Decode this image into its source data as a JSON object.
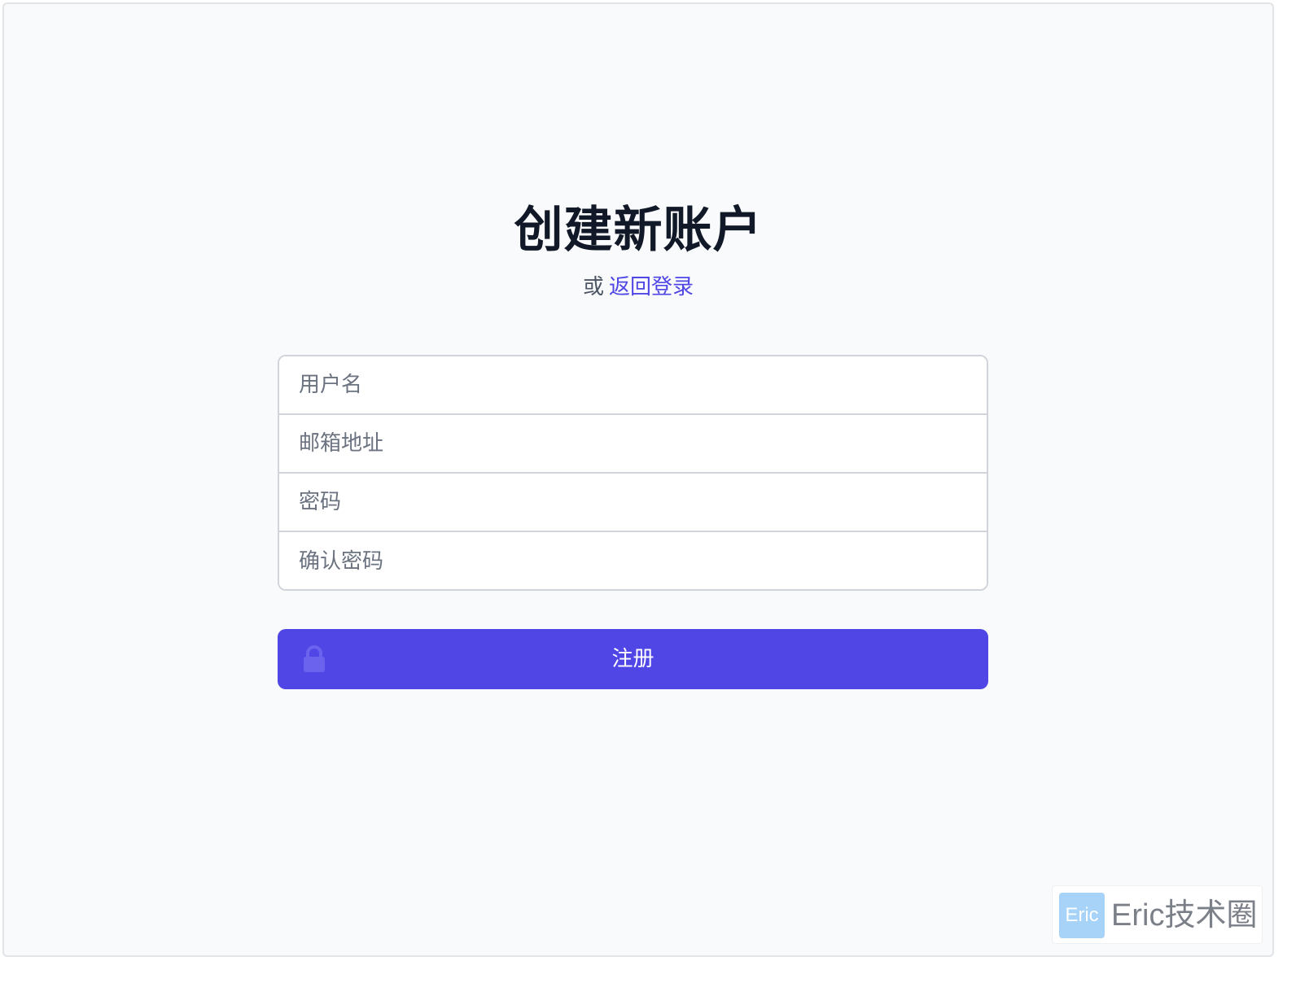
{
  "page": {
    "title": "创建新账户",
    "subtitle_prefix": "或",
    "login_link": "返回登录"
  },
  "form": {
    "username_placeholder": "用户名",
    "email_placeholder": "邮箱地址",
    "password_placeholder": "密码",
    "confirm_password_placeholder": "确认密码",
    "submit_label": "注册",
    "submit_icon": "lock-icon"
  },
  "watermark": {
    "badge": "Eric",
    "text": "Eric技术圈"
  },
  "colors": {
    "accent": "#4f46e5",
    "background": "#f9fafb",
    "title": "#111827",
    "muted": "#4b5563"
  }
}
